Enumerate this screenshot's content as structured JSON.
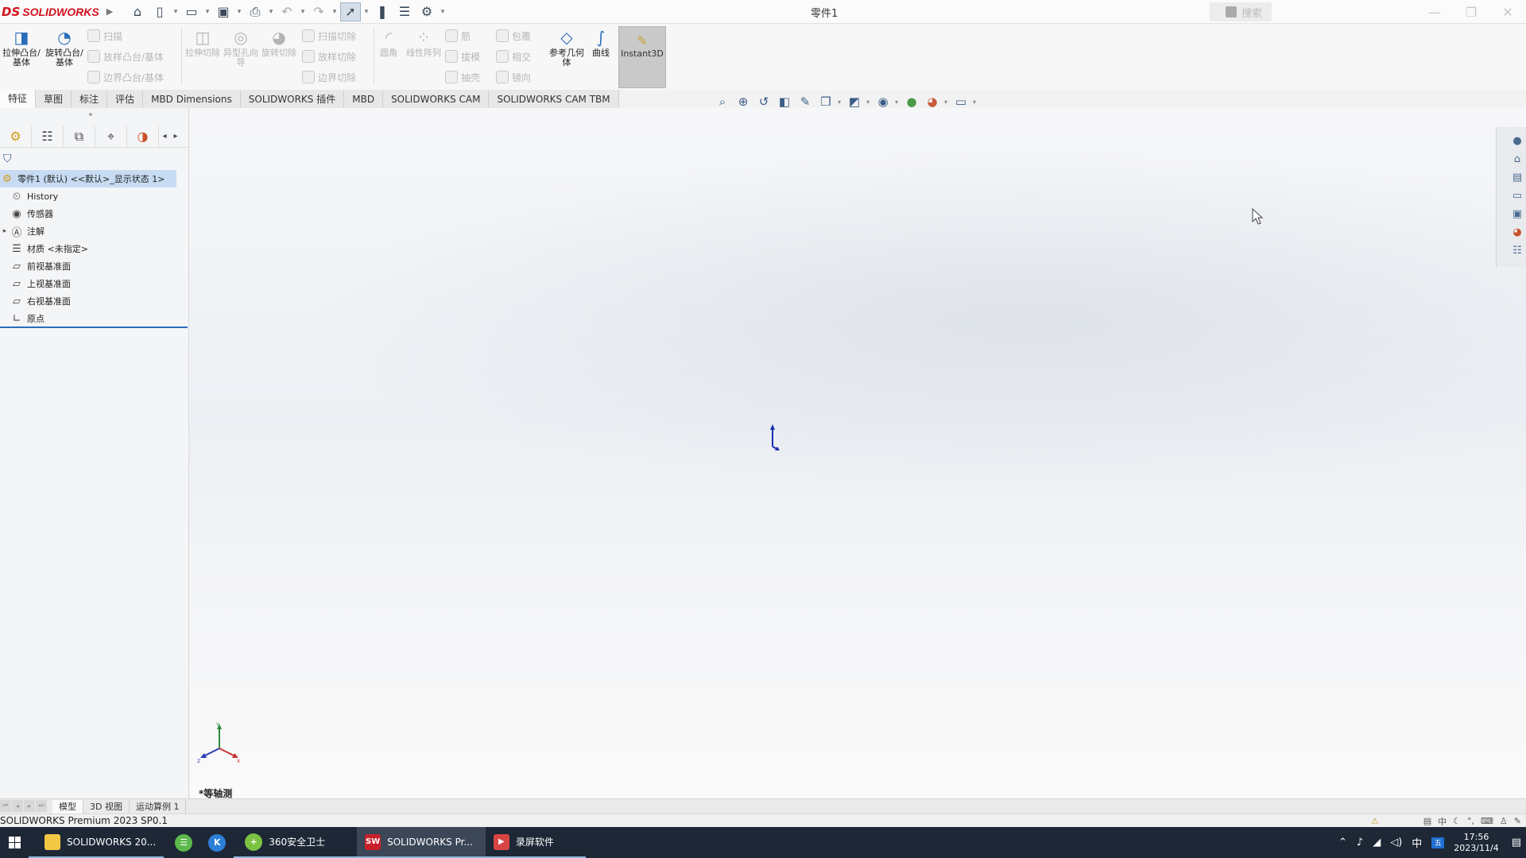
{
  "titlebar": {
    "brand_ds": "DS",
    "brand_name": "SOLIDWORKS",
    "document_title": "零件1",
    "help_search": "搜索"
  },
  "command_manager": {
    "extrude_boss": "拉伸凸台/基体",
    "revolve_boss": "旋转凸台/基体",
    "sweep": "扫描",
    "loft_boss": "放样凸台/基体",
    "boundary_boss": "边界凸台/基体",
    "extrude_cut": "拉伸切除",
    "hole_wizard": "异型孔向导",
    "revolve_cut": "旋转切除",
    "swept_cut": "扫描切除",
    "lofted_cut": "放样切除",
    "boundary_cut": "边界切除",
    "fillet": "圆角",
    "linear_pattern": "线性阵列",
    "rib": "筋",
    "draft": "拔模",
    "shell": "抽壳",
    "wrap": "包覆",
    "intersect": "相交",
    "mirror": "镜向",
    "ref_geometry": "参考几何体",
    "curves": "曲线",
    "instant3d": "Instant3D"
  },
  "tabs": [
    {
      "label": "特征",
      "active": true
    },
    {
      "label": "草图",
      "active": false
    },
    {
      "label": "标注",
      "active": false
    },
    {
      "label": "评估",
      "active": false
    },
    {
      "label": "MBD Dimensions",
      "active": false
    },
    {
      "label": "SOLIDWORKS 插件",
      "active": false
    },
    {
      "label": "MBD",
      "active": false
    },
    {
      "label": "SOLIDWORKS CAM",
      "active": false
    },
    {
      "label": "SOLIDWORKS CAM TBM",
      "active": false
    }
  ],
  "feature_tree": {
    "root": "零件1 (默认) <<默认>_显示状态 1>",
    "items": [
      {
        "label": "History",
        "icon": "history-icon"
      },
      {
        "label": "传感器",
        "icon": "sensor-icon"
      },
      {
        "label": "注解",
        "icon": "annotation-icon"
      },
      {
        "label": "材质 <未指定>",
        "icon": "material-icon"
      },
      {
        "label": "前视基准面",
        "icon": "plane-icon"
      },
      {
        "label": "上视基准面",
        "icon": "plane-icon"
      },
      {
        "label": "右视基准面",
        "icon": "plane-icon"
      },
      {
        "label": "原点",
        "icon": "origin-icon"
      }
    ]
  },
  "viewport": {
    "view_name": "*等轴测"
  },
  "bottom_tabs": [
    {
      "label": "模型",
      "active": true
    },
    {
      "label": "3D 视图",
      "active": false
    },
    {
      "label": "运动算例 1",
      "active": false
    }
  ],
  "status_bar": {
    "product": "SOLIDWORKS Premium 2023 SP0.1"
  },
  "taskbar": {
    "items": [
      {
        "label": "SOLIDWORKS 20...",
        "icon": "folder-icon",
        "color": "#f2c744"
      },
      {
        "label": "",
        "icon": "green-app-icon",
        "color": "#5db84b"
      },
      {
        "label": "",
        "icon": "k-app-icon",
        "color": "#2d7fd8"
      },
      {
        "label": "360安全卫士",
        "icon": "360-icon",
        "color": "#7cc242"
      },
      {
        "label": "SOLIDWORKS Pr...",
        "icon": "solidworks-icon",
        "color": "#c8202a"
      },
      {
        "label": "录屏软件",
        "icon": "recorder-icon",
        "color": "#d94444"
      }
    ],
    "ime": "中",
    "time": "17:56",
    "date": "2023/11/4"
  },
  "colors": {
    "accent": "#2a6ebb",
    "brand": "#d2111d",
    "tree_selection": "#c7dcf2",
    "taskbar": "#1d2736"
  }
}
